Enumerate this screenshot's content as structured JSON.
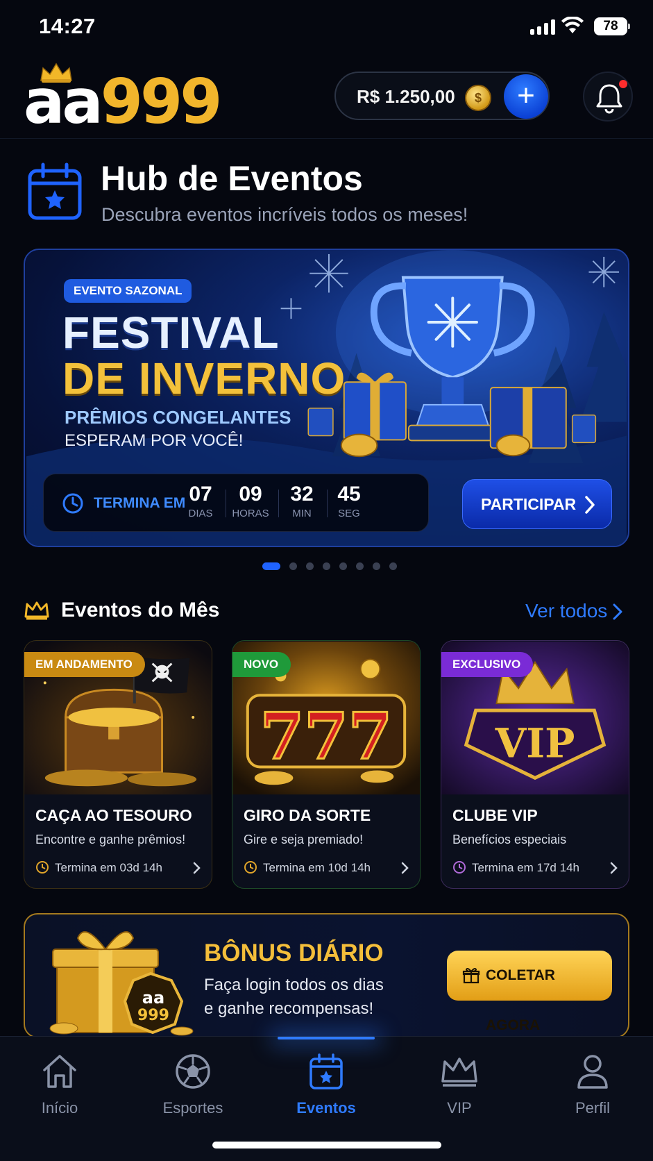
{
  "status_bar": {
    "time": "14:27",
    "battery": "78"
  },
  "header": {
    "logo_aa": "aa",
    "logo_999": "999",
    "balance": "R$ 1.250,00",
    "coin_symbol": "$",
    "add_symbol": "+"
  },
  "hub": {
    "title": "Hub de Eventos",
    "subtitle": "Descubra eventos incríveis todos os meses!"
  },
  "banner": {
    "tag": "EVENTO SAZONAL",
    "title_line1": "FESTIVAL",
    "title_line2": "DE INVERNO",
    "sub_line1": "PRÊMIOS CONGELANTES",
    "sub_line2": "ESPERAM POR VOCÊ!",
    "ends_label": "TERMINA EM",
    "countdown": [
      {
        "value": "07",
        "unit": "DIAS"
      },
      {
        "value": "09",
        "unit": "HORAS"
      },
      {
        "value": "32",
        "unit": "MIN"
      },
      {
        "value": "45",
        "unit": "SEG"
      }
    ],
    "cta": "PARTICIPAR"
  },
  "carousel": {
    "total": 8,
    "active_index": 0
  },
  "events": {
    "section_title": "Eventos do Mês",
    "see_all": "Ver todos",
    "cards": [
      {
        "badge": "EM ANDAMENTO",
        "badge_color": "#c98a12",
        "title": "CAÇA AO TESOURO",
        "desc": "Encontre e ganhe prêmios!",
        "ends": "Termina em 03d 14h"
      },
      {
        "badge": "NOVO",
        "badge_color": "#1f9a3a",
        "title": "GIRO DA SORTE",
        "desc": "Gire e seja premiado!",
        "ends": "Termina em 10d 14h"
      },
      {
        "badge": "EXCLUSIVO",
        "badge_color": "#7a2bd6",
        "title": "CLUBE VIP",
        "desc": "Benefícios especiais",
        "ends": "Termina em 17d 14h"
      }
    ]
  },
  "bonus": {
    "title": "BÔNUS DIÁRIO",
    "desc_line1": "Faça login todos os dias",
    "desc_line2": "e ganhe recompensas!",
    "cta": "COLETAR AGORA",
    "gift_aa": "aa",
    "gift_999": "999"
  },
  "nav": {
    "items": [
      {
        "label": "Início",
        "icon": "home-icon"
      },
      {
        "label": "Esportes",
        "icon": "soccer-ball-icon"
      },
      {
        "label": "Eventos",
        "icon": "calendar-star-icon"
      },
      {
        "label": "VIP",
        "icon": "crown-icon"
      },
      {
        "label": "Perfil",
        "icon": "user-icon"
      }
    ],
    "active": "Eventos"
  },
  "colors": {
    "accent_blue": "#2f7bff",
    "gold": "#f3c13b",
    "background": "#05070f"
  }
}
